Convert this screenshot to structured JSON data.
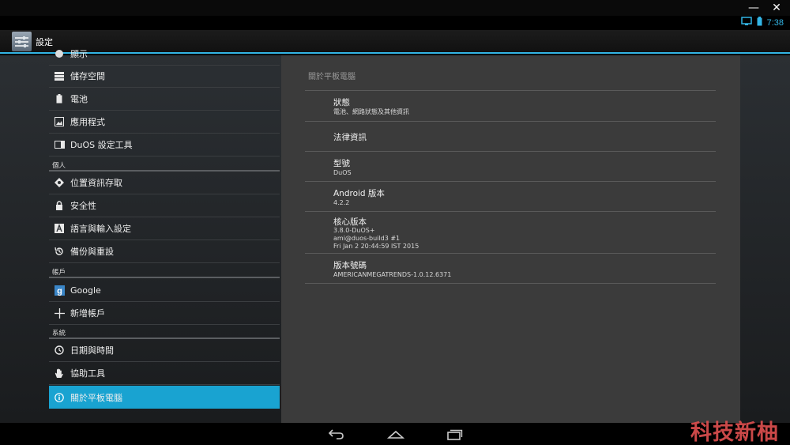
{
  "window": {
    "min_glyph": "—",
    "close_glyph": "✕"
  },
  "status": {
    "time": "7:38",
    "accent": "#33b5e5"
  },
  "app": {
    "title": "設定",
    "icon": "settings-app-icon"
  },
  "left": {
    "partial_top": {
      "label": "顯示",
      "icon": "display-icon"
    },
    "items_device": [
      {
        "label": "儲存空間",
        "icon": "storage-icon"
      },
      {
        "label": "電池",
        "icon": "battery-icon"
      },
      {
        "label": "應用程式",
        "icon": "apps-icon"
      },
      {
        "label": "DuOS 設定工具",
        "icon": "duos-icon"
      }
    ],
    "section_personal": "個人",
    "items_personal": [
      {
        "label": "位置資訊存取",
        "icon": "location-icon"
      },
      {
        "label": "安全性",
        "icon": "lock-icon"
      },
      {
        "label": "語言與輸入設定",
        "icon": "language-icon"
      },
      {
        "label": "備份與重設",
        "icon": "backup-icon"
      }
    ],
    "section_accounts": "帳戶",
    "items_accounts": [
      {
        "label": "Google",
        "icon": "google-icon"
      },
      {
        "label": "新增帳戶",
        "icon": "plus-icon"
      }
    ],
    "section_system": "系統",
    "items_system": [
      {
        "label": "日期與時間",
        "icon": "clock-icon"
      },
      {
        "label": "協助工具",
        "icon": "hand-icon"
      },
      {
        "label": "關於平板電腦",
        "icon": "info-icon",
        "selected": true
      }
    ]
  },
  "right": {
    "header": "關於平板電腦",
    "items": [
      {
        "title": "狀態",
        "sub": [
          "電池、網路狀態及其他資訊"
        ]
      },
      {
        "title": "法律資訊",
        "sub": []
      },
      {
        "title": "型號",
        "sub": [
          "DuOS"
        ]
      },
      {
        "title": "Android 版本",
        "sub": [
          "4.2.2"
        ]
      },
      {
        "title": "核心版本",
        "sub": [
          "3.8.0-DuOS+",
          "ami@duos-build3 #1",
          "Fri Jan 2 20:44:59 IST 2015"
        ]
      },
      {
        "title": "版本號碼",
        "sub": [
          "AMERICANMEGATRENDS-1.0.12.6371"
        ]
      }
    ]
  },
  "nav": {
    "back": "back-icon",
    "home": "home-icon",
    "recents": "recents-icon"
  },
  "watermark": "科技新柚"
}
